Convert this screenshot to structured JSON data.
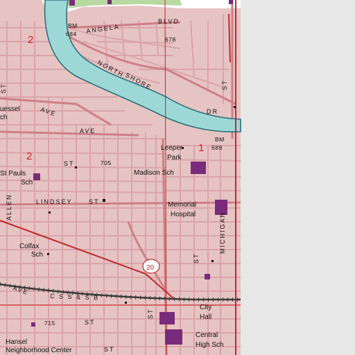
{
  "map": {
    "colors": {
      "urban": "#e6c4c4",
      "street": "#cf7f86",
      "street_minor": "#dba4a8",
      "river": "#9ed8d6",
      "river_bank": "#2a6f78",
      "highway": "#c0282c",
      "railroad": "#3a3a3a",
      "building": "#7a2a7a",
      "park_green": "#b9d9a3",
      "section_red": "#d21f1f",
      "white_area": "#ffffff",
      "right_panel": "#e8e8e8"
    },
    "labels": {
      "bm_684": "BM",
      "bm_684_value": "684",
      "angela_blvd": "ANGELA",
      "blvd": "BLVD",
      "elev_678": "678",
      "north_shore": "NORTH",
      "shore": "SHORE",
      "dr": "DR",
      "bm_689": "BM",
      "bm_689_value": "689",
      "leeper_park_1": "Leeper",
      "leeper_park_2": "Park",
      "madison_sch": "Madison Sch",
      "section_1": "1",
      "section_2a": "2",
      "section_2b": "2",
      "fuessel": "uessel",
      "fuessel_sch": "ch",
      "ave_1": "AVE",
      "ave_2": "AVE",
      "st_1": "ST",
      "st_paul": "St Pauls",
      "st_paul_sch": "Sch",
      "st_2": "ST",
      "elev_705": "705",
      "allen": "ALLEN",
      "lindsey": "LINDSEY",
      "st_3": "ST",
      "memorial": "Memorial",
      "hospital": "Hospital",
      "colfax": "Colfax",
      "colfax_sch": "Sch",
      "st_4": "ST",
      "route_20": "20",
      "michigan": "MICHIGAN",
      "st_5": "ST",
      "css_sb": "C S S & S B",
      "ave_3": "AVE",
      "city": "City",
      "hall": "Hall",
      "elev_715": "715",
      "st_6": "ST",
      "st_7": "ST",
      "central": "Central",
      "high_sch": "High Sch",
      "hansel": "Hansel",
      "neighborhood_center": "Neighborhood Center",
      "st_8": "ST"
    }
  }
}
